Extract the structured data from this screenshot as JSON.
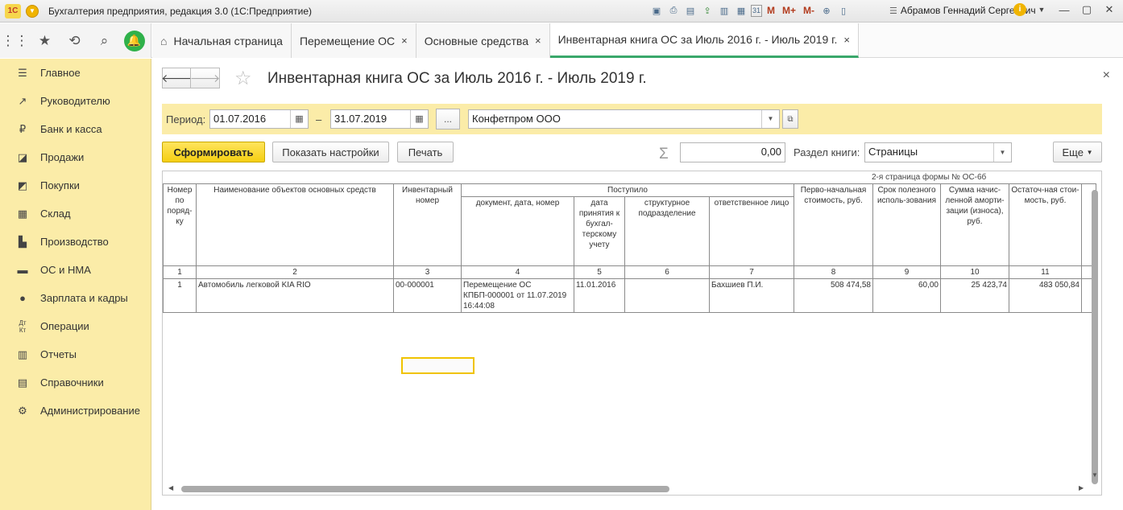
{
  "window": {
    "title": "Бухгалтерия предприятия, редакция 3.0  (1С:Предприятие)",
    "logo": "1С",
    "user": "Абрамов Геннадий Сергеевич",
    "memory_buttons": [
      "M",
      "M+",
      "M-"
    ],
    "calendar_day": "31"
  },
  "tabs": [
    {
      "label": "Начальная страница"
    },
    {
      "label": "Перемещение ОС",
      "close": "×"
    },
    {
      "label": "Основные средства",
      "close": "×"
    },
    {
      "label": "Инвентарная книга ОС за Июль 2016 г. - Июль 2019 г.",
      "close": "×",
      "active": true
    }
  ],
  "sidebar": {
    "items": [
      {
        "label": "Главное",
        "icon": "menu-icon"
      },
      {
        "label": "Руководителю",
        "icon": "trend-icon"
      },
      {
        "label": "Банк и касса",
        "icon": "ruble-icon"
      },
      {
        "label": "Продажи",
        "icon": "cart-icon"
      },
      {
        "label": "Покупки",
        "icon": "truck-icon"
      },
      {
        "label": "Склад",
        "icon": "warehouse-icon"
      },
      {
        "label": "Производство",
        "icon": "factory-icon"
      },
      {
        "label": "ОС и НМА",
        "icon": "assets-icon"
      },
      {
        "label": "Зарплата и кадры",
        "icon": "person-icon"
      },
      {
        "label": "Операции",
        "icon": "operations-icon"
      },
      {
        "label": "Отчеты",
        "icon": "chart-icon"
      },
      {
        "label": "Справочники",
        "icon": "book-icon"
      },
      {
        "label": "Администрирование",
        "icon": "gear-icon"
      }
    ]
  },
  "form": {
    "title": "Инвентарная книга ОС за Июль 2016 г. - Июль 2019 г.",
    "period_label": "Период:",
    "date_from": "01.07.2016",
    "dash": "–",
    "date_to": "31.07.2019",
    "ellipsis": "...",
    "organization": "Конфетпром ООО",
    "generate_button": "Сформировать",
    "settings_button": "Показать настройки",
    "print_button": "Печать",
    "sum_value": "0,00",
    "section_label": "Раздел книги:",
    "section_value": "Страницы",
    "more_button": "Еще"
  },
  "report": {
    "form_number": "2-я страница формы № ОС-6б",
    "headers": {
      "num": "Номер по поряд-ку",
      "name": "Наименование объектов основных средств",
      "inv": "Инвентарный номер",
      "received": "Поступило",
      "doc": "документ, дата, номер",
      "date_acc": "дата принятия к бухгал-терскому учету",
      "division": "структурное подразделение",
      "person": "ответственное лицо",
      "initial_cost": "Перво-начальная стоимость, руб.",
      "useful_life": "Срок полезного исполь-зования",
      "depreciation": "Сумма начис-ленной аморти-зации (износа), руб.",
      "residual": "Остаточ-ная стои-мость, руб."
    },
    "column_numbers": [
      "1",
      "2",
      "3",
      "4",
      "5",
      "6",
      "7",
      "8",
      "9",
      "10",
      "11"
    ],
    "rows": [
      {
        "num": "1",
        "name": "Автомобиль легковой KIA RIO",
        "inv": "00-000001",
        "doc": "Перемещение ОС КПБП-000001 от 11.07.2019 16:44:08",
        "date_acc": "11.01.2016",
        "division": "",
        "person": "Бахшиев П.И.",
        "initial_cost": "508 474,58",
        "useful_life": "60,00",
        "depreciation": "25 423,74",
        "residual": "483 050,84"
      }
    ]
  }
}
